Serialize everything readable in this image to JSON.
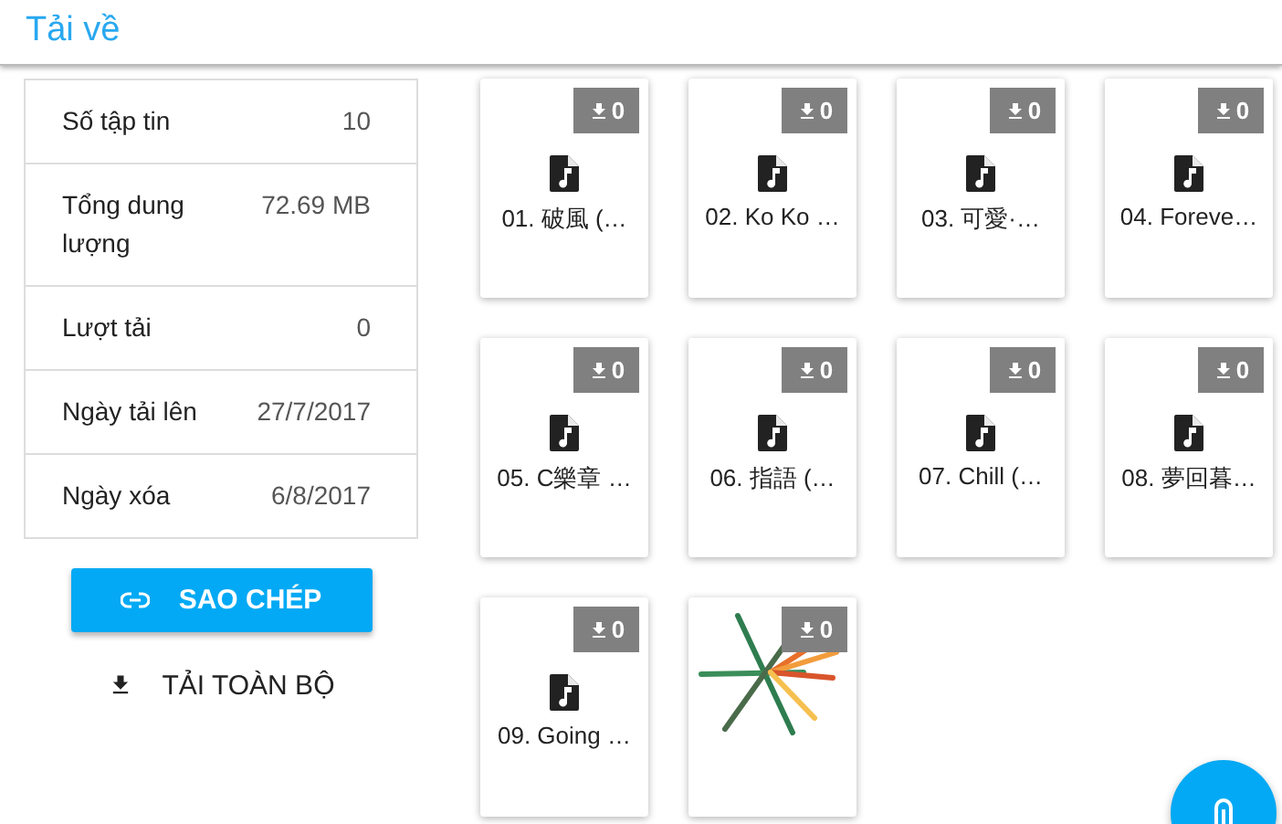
{
  "header": {
    "title": "Tải về"
  },
  "info": [
    {
      "label": "Số tập tin",
      "value": "10"
    },
    {
      "label": "Tổng dung lượng",
      "value": "72.69 MB"
    },
    {
      "label": "Lượt tải",
      "value": "0"
    },
    {
      "label": "Ngày tải lên",
      "value": "27/7/2017"
    },
    {
      "label": "Ngày xóa",
      "value": "6/8/2017"
    }
  ],
  "buttons": [
    {
      "kind": "primary",
      "label": "SAO CHÉP"
    },
    {
      "kind": "flat",
      "label": "TẢI TOÀN BỘ"
    }
  ],
  "files": [
    {
      "kind": "audio",
      "name": "01. 破風 (…",
      "downloads": "0"
    },
    {
      "kind": "audio",
      "name": "02. Ko Ko …",
      "downloads": "0"
    },
    {
      "kind": "audio",
      "name": "03. 可愛·…",
      "downloads": "0"
    },
    {
      "kind": "audio",
      "name": "04. Foreve…",
      "downloads": "0"
    },
    {
      "kind": "audio",
      "name": "05. C樂章 …",
      "downloads": "0"
    },
    {
      "kind": "audio",
      "name": "06. 指語 (…",
      "downloads": "0"
    },
    {
      "kind": "audio",
      "name": "07. Chill (…",
      "downloads": "0"
    },
    {
      "kind": "audio",
      "name": "08. 夢回暮…",
      "downloads": "0"
    },
    {
      "kind": "audio",
      "name": "09. Going …",
      "downloads": "0"
    },
    {
      "kind": "image",
      "downloads": "0"
    }
  ]
}
